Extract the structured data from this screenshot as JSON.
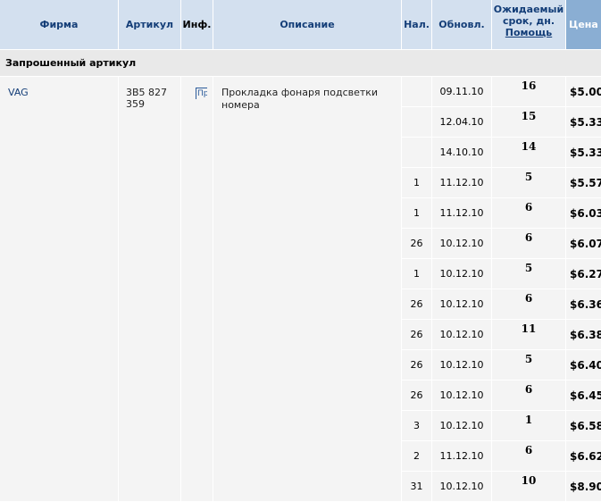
{
  "columns": {
    "firm": "Фирма",
    "article": "Артикул",
    "info": "Инф.",
    "description": "Описание",
    "qty": "Нал.",
    "updated": "Обновл.",
    "eta_line1": "Ожидаемый",
    "eta_line2": "срок, дн.",
    "eta_help": "Помощь",
    "price": "Цена"
  },
  "section": {
    "title": "Запрошенный артикул"
  },
  "item": {
    "firm": "VAG",
    "article": "3B5 827 359",
    "info_icon_label": "Пр",
    "description": "Прокладка фонаря подсветки номера"
  },
  "offers": [
    {
      "qty": "",
      "updated": "09.11.10",
      "eta": "16",
      "price": "$5.00"
    },
    {
      "qty": "",
      "updated": "12.04.10",
      "eta": "15",
      "price": "$5.33"
    },
    {
      "qty": "",
      "updated": "14.10.10",
      "eta": "14",
      "price": "$5.33"
    },
    {
      "qty": "1",
      "updated": "11.12.10",
      "eta": "5",
      "price": "$5.57"
    },
    {
      "qty": "1",
      "updated": "11.12.10",
      "eta": "6",
      "price": "$6.03"
    },
    {
      "qty": "26",
      "updated": "10.12.10",
      "eta": "6",
      "price": "$6.07"
    },
    {
      "qty": "1",
      "updated": "10.12.10",
      "eta": "5",
      "price": "$6.27"
    },
    {
      "qty": "26",
      "updated": "10.12.10",
      "eta": "6",
      "price": "$6.36"
    },
    {
      "qty": "26",
      "updated": "10.12.10",
      "eta": "11",
      "price": "$6.38"
    },
    {
      "qty": "26",
      "updated": "10.12.10",
      "eta": "5",
      "price": "$6.40"
    },
    {
      "qty": "26",
      "updated": "10.12.10",
      "eta": "6",
      "price": "$6.45"
    },
    {
      "qty": "3",
      "updated": "10.12.10",
      "eta": "1",
      "price": "$6.58"
    },
    {
      "qty": "2",
      "updated": "11.12.10",
      "eta": "6",
      "price": "$6.62"
    },
    {
      "qty": "31",
      "updated": "10.12.10",
      "eta": "10",
      "price": "$8.90"
    }
  ]
}
